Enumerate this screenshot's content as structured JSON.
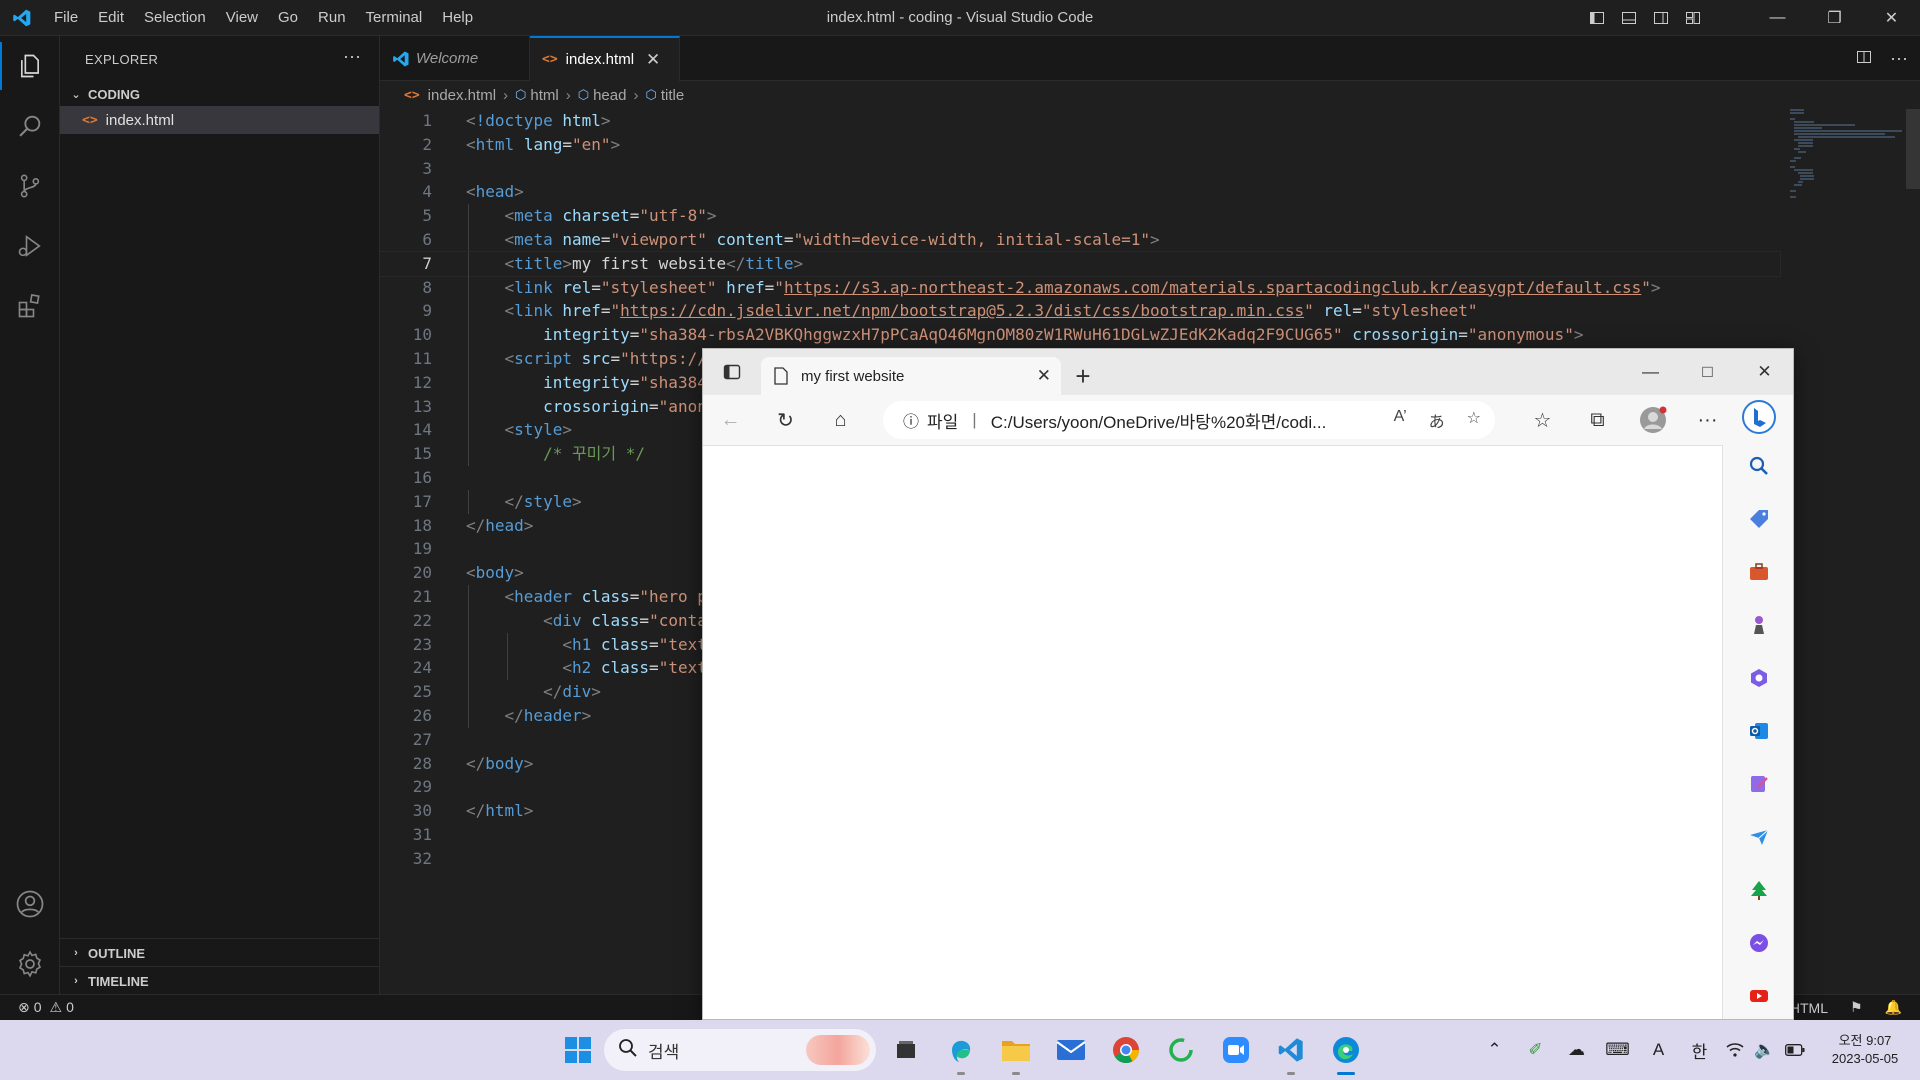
{
  "window": {
    "title": "index.html - coding - Visual Studio Code"
  },
  "menu": [
    "File",
    "Edit",
    "Selection",
    "View",
    "Go",
    "Run",
    "Terminal",
    "Help"
  ],
  "sidebar": {
    "header": "EXPLORER",
    "folder": "CODING",
    "file": "index.html",
    "outline": "OUTLINE",
    "timeline": "TIMELINE"
  },
  "tabs": {
    "welcome": "Welcome",
    "active": "index.html"
  },
  "breadcrumb": [
    "index.html",
    "html",
    "head",
    "title"
  ],
  "code_lines": [
    "<!doctype html>",
    "<html lang=\"en\">",
    "",
    "<head>",
    "    <meta charset=\"utf-8\">",
    "    <meta name=\"viewport\" content=\"width=device-width, initial-scale=1\">",
    "    <title>my first website</title>",
    "    <link rel=\"stylesheet\" href=\"https://s3.ap-northeast-2.amazonaws.com/materials.spartacodingclub.kr/easygpt/default.css\">",
    "    <link href=\"https://cdn.jsdelivr.net/npm/bootstrap@5.2.3/dist/css/bootstrap.min.css\" rel=\"stylesheet\"",
    "        integrity=\"sha384-rbsA2VBKQhggwzxH7pPCaAqO46MgnOM80zW1RWuH61DGLwZJEdK2Kadq2F9CUG65\" crossorigin=\"anonymous\">",
    "    <script src=\"https://",
    "        integrity=\"sha384",
    "        crossorigin=\"anon",
    "    <style>",
    "        /* 꾸미기 */",
    "",
    "    </style>",
    "</head>",
    "",
    "<body>",
    "    <header class=\"hero p",
    "        <div class=\"conta",
    "          <h1 class=\"text",
    "          <h2 class=\"text",
    "        </div>",
    "    </header>",
    "",
    "</body>",
    "",
    "</html>",
    "",
    ""
  ],
  "current_line": 7,
  "status": {
    "errors": "0",
    "warnings": "0",
    "language": "HTML"
  },
  "browser": {
    "tab_title": "my first website",
    "address_label": "파일",
    "address_url": "C:/Users/yoon/OneDrive/바탕%20화면/codi..."
  },
  "taskbar": {
    "search_placeholder": "검색",
    "time": "오전 9:07",
    "date": "2023-05-05",
    "ime_a": "A",
    "ime_han": "한"
  },
  "colors": {
    "accent": "#0078d4",
    "editor_bg": "#1f1f1f",
    "taskbar_bg": "#dcd8ee"
  }
}
